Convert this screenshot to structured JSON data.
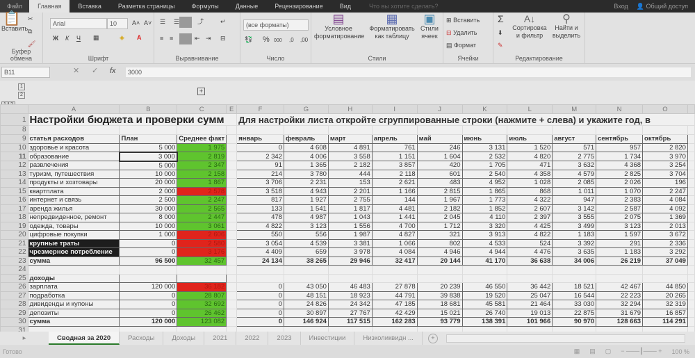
{
  "titlebar": {
    "tabs": [
      "Файл",
      "Главная",
      "Вставка",
      "Разметка страницы",
      "Формулы",
      "Данные",
      "Рецензирование",
      "Вид"
    ],
    "active": 1,
    "tell_me": "Что вы хотите сделать?",
    "signin": "Вход",
    "share": "Общий доступ"
  },
  "ribbon": {
    "clipboard": {
      "paste": "Вставить",
      "label": "Буфер обмена"
    },
    "font": {
      "name": "Arial",
      "size": "10",
      "bold": "Ж",
      "italic": "К",
      "underline": "Ч",
      "label": "Шрифт"
    },
    "alignment": {
      "label": "Выравнивание"
    },
    "number": {
      "format": "(все форматы)",
      "percent": "%",
      "thousands": "000",
      "label": "Число"
    },
    "styles": {
      "conditional": "Условное форматирование",
      "format_table": "Форматировать как таблицу",
      "cell_styles": "Стили ячеек",
      "label": "Стили"
    },
    "cells": {
      "insert": "Вставить",
      "delete": "Удалить",
      "format": "Формат",
      "label": "Ячейки"
    },
    "editing": {
      "sort": "Сортировка и фильтр",
      "find": "Найти и выделить",
      "label": "Редактирование"
    }
  },
  "formula_bar": {
    "name_box": "B11",
    "value": "3000"
  },
  "sheet": {
    "columns": [
      "A",
      "B",
      "C",
      "E",
      "F",
      "G",
      "H",
      "I",
      "J",
      "K",
      "L",
      "M",
      "N",
      "O"
    ],
    "title_left": "Настройки бюджета и проверки сумм",
    "title_right": "Для настройки листа откройте сгруппированные строки (нажмите + слева) и укажите год, в",
    "header": {
      "category": "статья расходов",
      "plan": "План",
      "fact": "Среднее факт"
    },
    "months": [
      "январь",
      "февраль",
      "март",
      "апрель",
      "май",
      "июнь",
      "июль",
      "август",
      "сентябрь",
      "октябрь"
    ],
    "expenses": [
      {
        "row": "10",
        "label": "здоровье и красота",
        "plan": "5 000",
        "fact": "1 975",
        "status": "ok",
        "months": [
          "0",
          "4 608",
          "4 891",
          "761",
          "246",
          "3 131",
          "1 520",
          "571",
          "957",
          "2 820"
        ]
      },
      {
        "row": "11",
        "label": "образование",
        "plan": "3 000",
        "fact": "2 819",
        "status": "ok",
        "months": [
          "2 342",
          "4 006",
          "3 558",
          "1 151",
          "1 604",
          "2 532",
          "4 820",
          "2 775",
          "1 734",
          "3 970"
        ]
      },
      {
        "row": "12",
        "label": "развлечения",
        "plan": "5 000",
        "fact": "2 347",
        "status": "ok",
        "months": [
          "91",
          "1 365",
          "2 182",
          "3 857",
          "420",
          "1 705",
          "471",
          "3 632",
          "4 368",
          "3 254"
        ]
      },
      {
        "row": "13",
        "label": "туризм, путешествия",
        "plan": "10 000",
        "fact": "2 158",
        "status": "ok",
        "months": [
          "214",
          "3 780",
          "444",
          "2 118",
          "601",
          "2 540",
          "4 358",
          "4 579",
          "2 825",
          "3 704"
        ]
      },
      {
        "row": "14",
        "label": "продукты и хозтовары",
        "plan": "20 000",
        "fact": "1 867",
        "status": "ok",
        "months": [
          "3 706",
          "2 231",
          "153",
          "2 621",
          "483",
          "4 952",
          "1 028",
          "2 085",
          "2 026",
          "196"
        ]
      },
      {
        "row": "15",
        "label": "квартплата",
        "plan": "2 000",
        "fact": "2 578",
        "status": "over",
        "months": [
          "3 518",
          "4 943",
          "2 201",
          "1 166",
          "2 815",
          "1 865",
          "868",
          "1 011",
          "1 070",
          "2 247"
        ]
      },
      {
        "row": "16",
        "label": "интернет и связь",
        "plan": "2 500",
        "fact": "2 247",
        "status": "ok",
        "months": [
          "817",
          "1 927",
          "2 755",
          "144",
          "1 967",
          "1 773",
          "4 322",
          "947",
          "2 383",
          "4 084"
        ]
      },
      {
        "row": "17",
        "label": "аренда жилья",
        "plan": "30 000",
        "fact": "2 565",
        "status": "ok",
        "months": [
          "133",
          "1 541",
          "1 817",
          "4 481",
          "2 182",
          "1 852",
          "2 607",
          "3 142",
          "2 587",
          "4 092"
        ]
      },
      {
        "row": "18",
        "label": "непредвиденное, ремонт",
        "plan": "8 000",
        "fact": "2 447",
        "status": "ok",
        "months": [
          "478",
          "4 987",
          "1 043",
          "1 441",
          "2 045",
          "4 110",
          "2 397",
          "3 555",
          "2 075",
          "1 369"
        ]
      },
      {
        "row": "19",
        "label": "одежда, товары",
        "plan": "10 000",
        "fact": "3 061",
        "status": "ok",
        "months": [
          "4 822",
          "3 123",
          "1 556",
          "4 700",
          "1 712",
          "3 320",
          "4 425",
          "3 499",
          "3 123",
          "2 013"
        ]
      },
      {
        "row": "20",
        "label": "цифровые покупки",
        "plan": "1 000",
        "fact": "2 606",
        "status": "over",
        "months": [
          "550",
          "556",
          "1 987",
          "4 827",
          "321",
          "3 913",
          "4 822",
          "1 183",
          "1 597",
          "3 672"
        ]
      },
      {
        "row": "21",
        "label": "крупные траты",
        "plan": "0",
        "fact": "2 580",
        "status": "over",
        "dark": true,
        "months": [
          "3 054",
          "4 539",
          "3 381",
          "1 066",
          "802",
          "4 533",
          "524",
          "3 392",
          "291",
          "2 336"
        ]
      },
      {
        "row": "22",
        "label": "чрезмерное потребление",
        "plan": "0",
        "fact": "3 176",
        "status": "over",
        "dark": true,
        "months": [
          "4 409",
          "659",
          "3 978",
          "4 084",
          "4 946",
          "4 944",
          "4 476",
          "3 635",
          "1 183",
          "3 292"
        ]
      },
      {
        "row": "23",
        "label": "сумма",
        "plan": "96 500",
        "fact": "32 457",
        "status": "ok",
        "total": true,
        "months": [
          "24 134",
          "38 265",
          "29 946",
          "32 417",
          "20 144",
          "41 170",
          "36 638",
          "34 006",
          "26 219",
          "37 049"
        ]
      }
    ],
    "income_header": "доходы",
    "income": [
      {
        "row": "26",
        "label": "зарплата",
        "plan": "120 000",
        "fact": "36 182",
        "status": "over",
        "months": [
          "0",
          "43 050",
          "46 483",
          "27 878",
          "20 239",
          "46 550",
          "36 442",
          "18 521",
          "42 467",
          "44 850"
        ]
      },
      {
        "row": "27",
        "label": "подработка",
        "plan": "0",
        "fact": "28 807",
        "status": "ok",
        "months": [
          "0",
          "48 151",
          "18 923",
          "44 791",
          "39 838",
          "19 520",
          "25 047",
          "16 544",
          "22 223",
          "20 265"
        ]
      },
      {
        "row": "28",
        "label": "дивиденды и купоны",
        "plan": "0",
        "fact": "32 692",
        "status": "ok",
        "months": [
          "0",
          "24 826",
          "24 342",
          "47 185",
          "18 681",
          "45 581",
          "21 464",
          "33 030",
          "32 294",
          "32 319"
        ]
      },
      {
        "row": "29",
        "label": "депозиты",
        "plan": "0",
        "fact": "26 462",
        "status": "ok",
        "months": [
          "0",
          "30 897",
          "27 767",
          "42 429",
          "15 021",
          "26 740",
          "19 013",
          "22 875",
          "31 679",
          "16 857"
        ]
      },
      {
        "row": "30",
        "label": "сумма",
        "plan": "120 000",
        "fact": "123 082",
        "status": "ok",
        "total": true,
        "months": [
          "0",
          "146 924",
          "117 515",
          "162 283",
          "93 779",
          "138 391",
          "101 966",
          "90 970",
          "128 663",
          "114 291"
        ]
      }
    ],
    "row_numbers": {
      "r1": "1",
      "r8": "8",
      "r9": "9",
      "r24": "24",
      "r25": "25",
      "r31": "31"
    }
  },
  "outline": {
    "levels": [
      "1",
      "2"
    ],
    "expand": "+"
  },
  "sheet_tabs": [
    "Сводная за 2020",
    "Расходы",
    "Доходы",
    "2021",
    "2022",
    "2023",
    "Инвестиции",
    "Низколиквидн ..."
  ],
  "active_tab": 0,
  "status": {
    "text": "Готово",
    "zoom": "100 %"
  },
  "colors": {
    "ok": "#5fc42e",
    "over": "#e0241c"
  }
}
